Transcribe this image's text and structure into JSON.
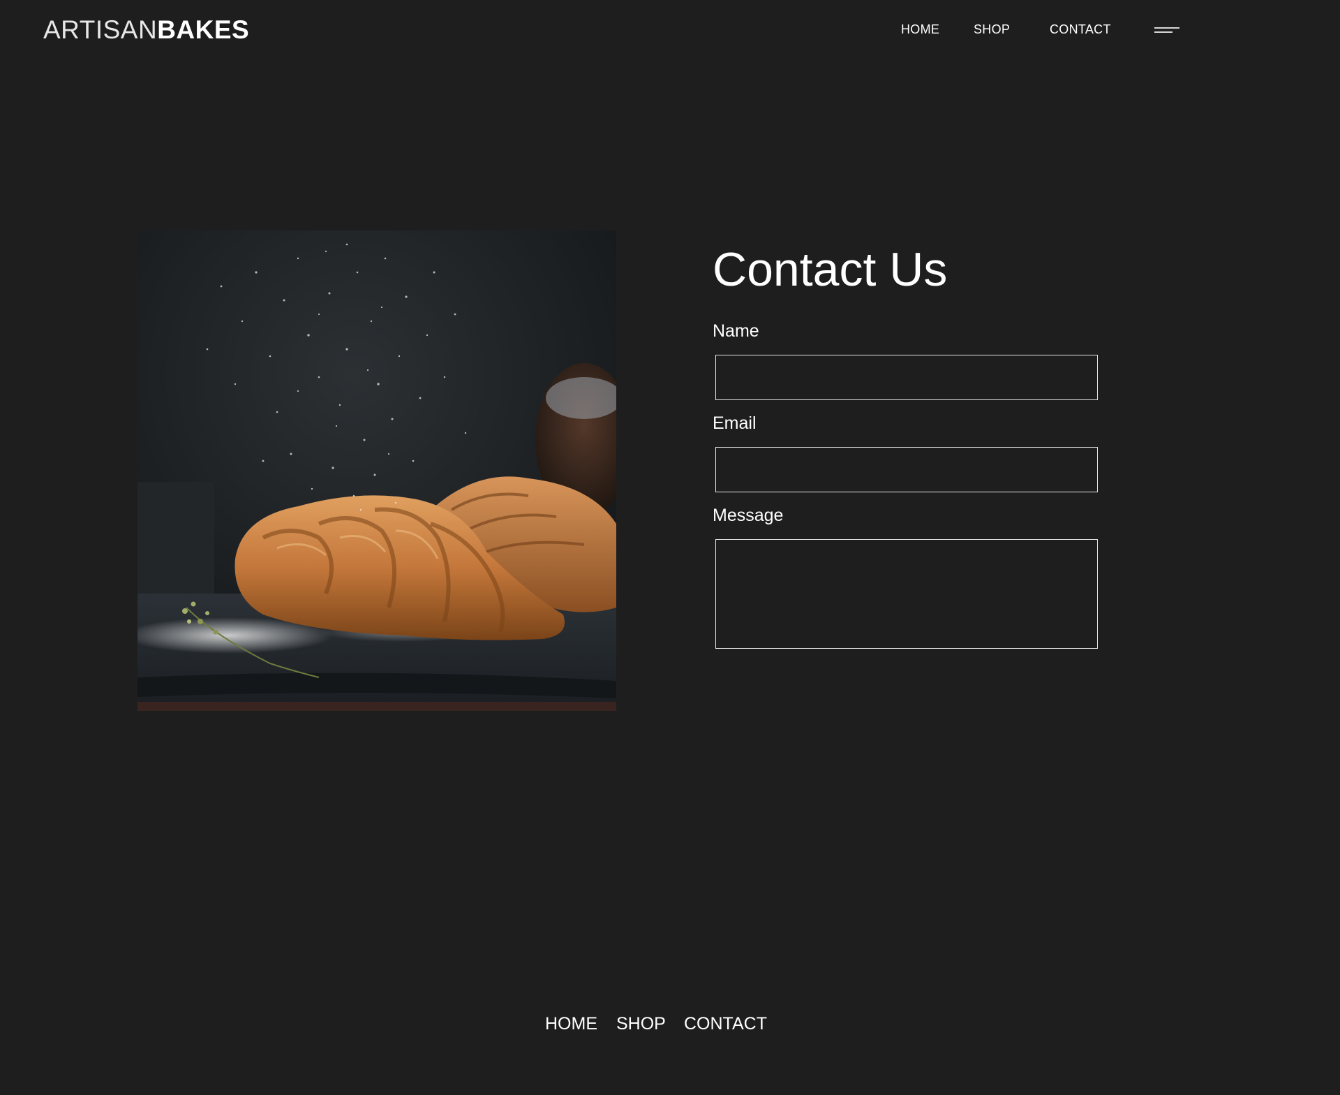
{
  "brand": {
    "light": "ARTISAN",
    "bold": "BAKES"
  },
  "header_nav": [
    {
      "label": "HOME"
    },
    {
      "label": "SHOP"
    },
    {
      "label": "CONTACT"
    }
  ],
  "menu_icon": "hamburger-menu-icon",
  "hero_image": {
    "subject": "croissants dusted with powdered sugar"
  },
  "contact": {
    "title": "Contact Us",
    "name_label": "Name",
    "name_value": "",
    "email_label": "Email",
    "email_value": "",
    "message_label": "Message",
    "message_value": ""
  },
  "footer_nav": [
    {
      "label": "HOME"
    },
    {
      "label": "SHOP"
    },
    {
      "label": "CONTACT"
    }
  ],
  "colors": {
    "background": "#1e1e1e",
    "text": "#ffffff",
    "field_border": "#e6e6e6"
  }
}
